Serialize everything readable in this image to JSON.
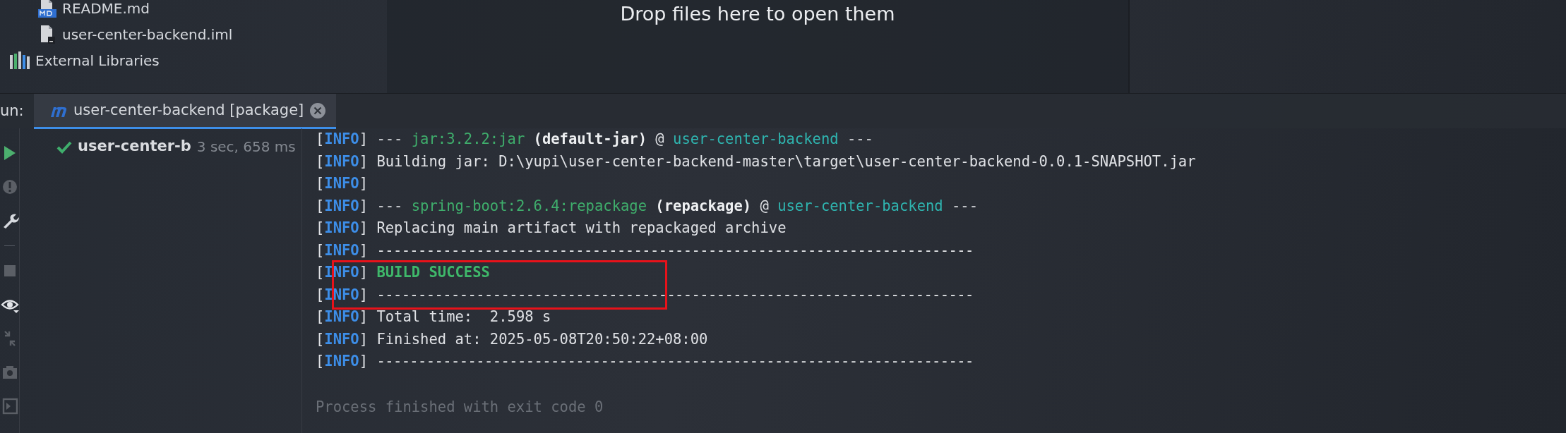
{
  "project_tree": {
    "items": [
      {
        "label": "README.md",
        "kind": "markdown"
      },
      {
        "label": "user-center-backend.iml",
        "kind": "module"
      },
      {
        "label": "External Libraries",
        "kind": "libraries"
      }
    ]
  },
  "editor": {
    "drop_hint": "Drop files here to open them"
  },
  "run_panel": {
    "label": "un:",
    "tabs": [
      {
        "label": "user-center-backend [package]",
        "selected": true
      }
    ],
    "tree": [
      {
        "label": "user-center-b",
        "duration": "3 sec, 658 ms",
        "kind": "success"
      }
    ],
    "console": {
      "lines": [
        [
          {
            "kind": "plain",
            "text": "["
          },
          {
            "kind": "tag",
            "text": "INFO"
          },
          {
            "kind": "plain",
            "text": "] --- "
          },
          {
            "kind": "plugin",
            "text": "jar:3.2.2:jar"
          },
          {
            "kind": "bold",
            "text": " (default-jar)"
          },
          {
            "kind": "plain",
            "text": " @ "
          },
          {
            "kind": "artifact",
            "text": "user-center-backend"
          },
          {
            "kind": "plain",
            "text": " ---"
          }
        ],
        [
          {
            "kind": "plain",
            "text": "["
          },
          {
            "kind": "tag",
            "text": "INFO"
          },
          {
            "kind": "plain",
            "text": "] Building jar: D:\\yupi\\user-center-backend-master\\target\\user-center-backend-0.0.1-SNAPSHOT.jar"
          }
        ],
        [
          {
            "kind": "plain",
            "text": "["
          },
          {
            "kind": "tag",
            "text": "INFO"
          },
          {
            "kind": "plain",
            "text": "]"
          }
        ],
        [
          {
            "kind": "plain",
            "text": "["
          },
          {
            "kind": "tag",
            "text": "INFO"
          },
          {
            "kind": "plain",
            "text": "] --- "
          },
          {
            "kind": "plugin",
            "text": "spring-boot:2.6.4:repackage"
          },
          {
            "kind": "bold",
            "text": " (repackage)"
          },
          {
            "kind": "plain",
            "text": " @ "
          },
          {
            "kind": "artifact",
            "text": "user-center-backend"
          },
          {
            "kind": "plain",
            "text": " ---"
          }
        ],
        [
          {
            "kind": "plain",
            "text": "["
          },
          {
            "kind": "tag",
            "text": "INFO"
          },
          {
            "kind": "plain",
            "text": "] Replacing main artifact with repackaged archive"
          }
        ],
        [
          {
            "kind": "plain",
            "text": "["
          },
          {
            "kind": "tag",
            "text": "INFO"
          },
          {
            "kind": "plain",
            "text": "] "
          },
          {
            "kind": "rule",
            "text": "------------------------------------------------------------------------"
          }
        ],
        [
          {
            "kind": "plain",
            "text": "["
          },
          {
            "kind": "tag",
            "text": "INFO"
          },
          {
            "kind": "plain",
            "text": "] "
          },
          {
            "kind": "success",
            "text": "BUILD SUCCESS"
          }
        ],
        [
          {
            "kind": "plain",
            "text": "["
          },
          {
            "kind": "tag",
            "text": "INFO"
          },
          {
            "kind": "plain",
            "text": "] "
          },
          {
            "kind": "rule",
            "text": "------------------------------------------------------------------------"
          }
        ],
        [
          {
            "kind": "plain",
            "text": "["
          },
          {
            "kind": "tag",
            "text": "INFO"
          },
          {
            "kind": "plain",
            "text": "] Total time:  2.598 s"
          }
        ],
        [
          {
            "kind": "plain",
            "text": "["
          },
          {
            "kind": "tag",
            "text": "INFO"
          },
          {
            "kind": "plain",
            "text": "] Finished at: 2025-05-08T20:50:22+08:00"
          }
        ],
        [
          {
            "kind": "plain",
            "text": "["
          },
          {
            "kind": "tag",
            "text": "INFO"
          },
          {
            "kind": "plain",
            "text": "] "
          },
          {
            "kind": "rule",
            "text": "------------------------------------------------------------------------"
          }
        ]
      ],
      "exit_message": "Process finished with exit code 0"
    }
  }
}
